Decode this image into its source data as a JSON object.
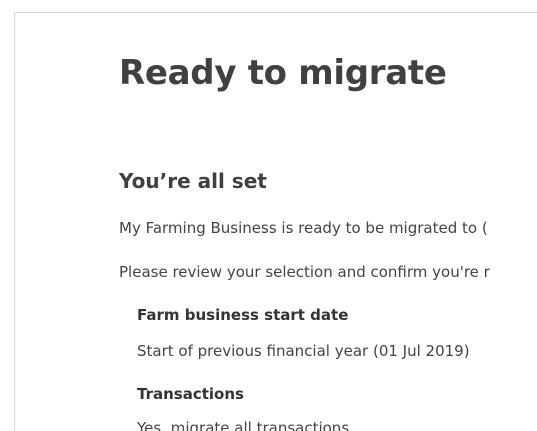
{
  "page": {
    "title": "Ready to migrate"
  },
  "section": {
    "title": "You’re all set",
    "paragraphs": [
      "My Farming Business is ready to be migrated to (",
      "Please review your selection and confirm you're r"
    ]
  },
  "details": [
    {
      "label": "Farm business start date",
      "value": "Start of previous financial year (01 Jul 2019)"
    },
    {
      "label": "Transactions",
      "value": "Yes, migrate all transactions"
    }
  ]
}
